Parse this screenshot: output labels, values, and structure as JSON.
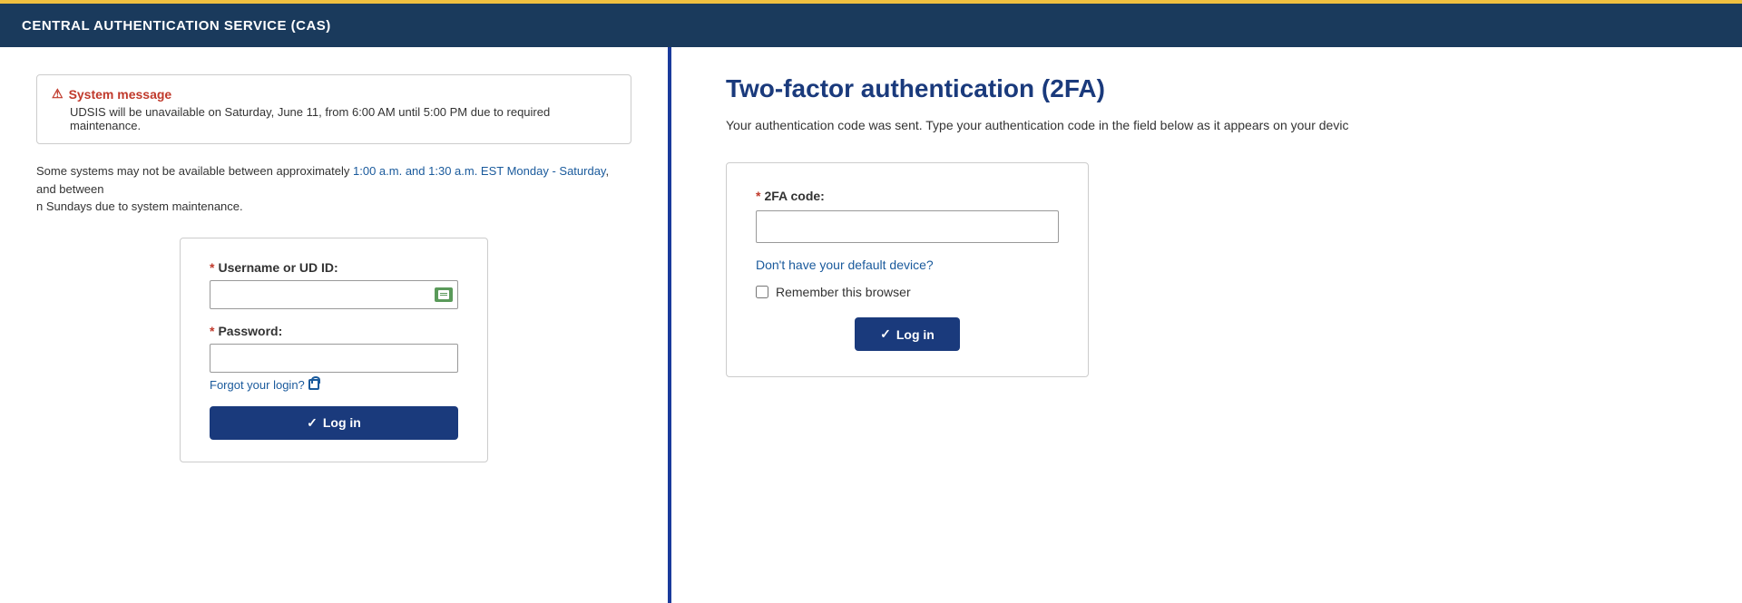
{
  "header": {
    "title": "CENTRAL AUTHENTICATION SERVICE (CAS)"
  },
  "left": {
    "alert": {
      "icon": "⚠",
      "title": "System message",
      "body": "UDSIS will be unavailable on Saturday, June 11, from 6:00 AM until 5:00 PM due to required maintenance."
    },
    "maintenance_note_before": "Some systems may not be available between approximately ",
    "maintenance_note_time": "1:00 a.m. and 1:30 a.m. EST Monday - Saturday",
    "maintenance_note_between": ", and betw",
    "maintenance_note_after": "n Sundays due to system maintenance.",
    "login_form": {
      "username_label": "Username or UD ID:",
      "username_placeholder": "",
      "password_label": "Password:",
      "password_placeholder": "",
      "forgot_link": "Forgot your login?",
      "login_button": "Log in"
    }
  },
  "right": {
    "title": "Two-factor authentication (2FA)",
    "description": "Your authentication code was sent. Type your authentication code in the field below as it appears on your devic",
    "twofa_box": {
      "code_label": "2FA code:",
      "code_placeholder": "",
      "no_device_link": "Don't have your default device?",
      "remember_label": "Remember this browser",
      "login_button": "Log in"
    }
  }
}
